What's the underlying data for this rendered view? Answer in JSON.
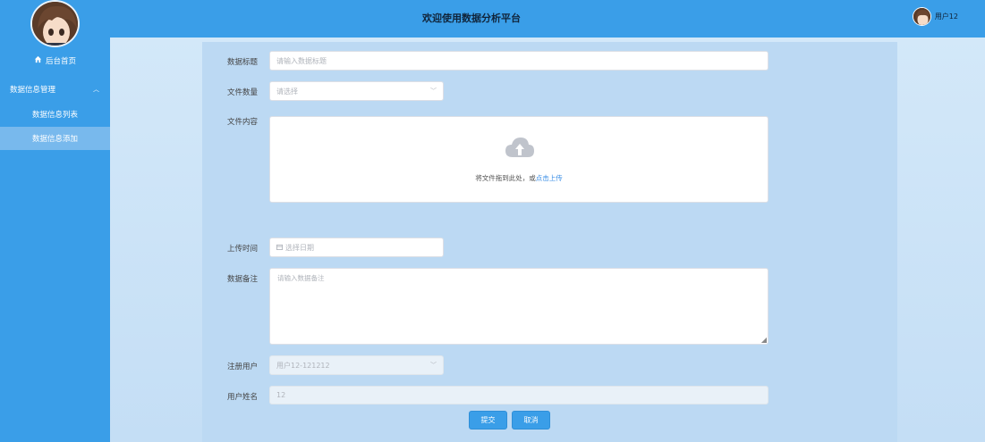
{
  "sidebar": {
    "home_label": "后台首页",
    "menu_group_label": "数据信息管理",
    "sub_items": [
      {
        "label": "数据信息列表"
      },
      {
        "label": "数据信息添加"
      }
    ]
  },
  "header": {
    "title": "欢迎使用数据分析平台",
    "user_name": "用户12"
  },
  "form": {
    "title_label": "数据标题",
    "title_placeholder": "请输入数据标题",
    "count_label": "文件数量",
    "count_placeholder": "请选择",
    "content_label": "文件内容",
    "upload_hint": "将文件拖到此处，或",
    "upload_link": "点击上传",
    "time_label": "上传时间",
    "time_placeholder": "选择日期",
    "note_label": "数据备注",
    "note_placeholder": "请输入数据备注",
    "reg_user_label": "注册用户",
    "reg_user_value": "用户12-121212",
    "user_name_label": "用户姓名",
    "user_name_value": "12",
    "submit_label": "提交",
    "cancel_label": "取消"
  },
  "colors": {
    "primary": "#3a9ee8",
    "link": "#3a8ee6",
    "active_menu": "#78b9ed"
  }
}
